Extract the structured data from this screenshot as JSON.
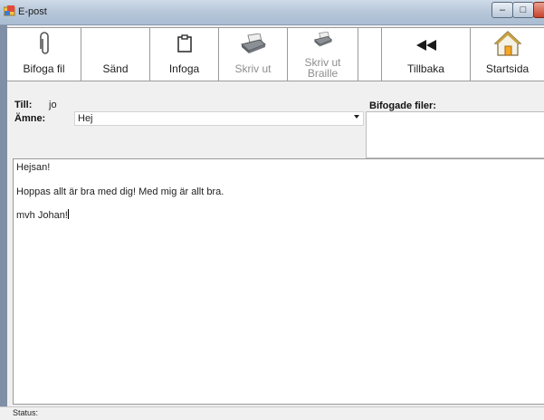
{
  "window": {
    "title": "E-post"
  },
  "toolbar": {
    "items": [
      {
        "label": "Bifoga fil",
        "icon": "paperclip-icon",
        "enabled": true
      },
      {
        "label": "Sänd",
        "icon": "",
        "enabled": true
      },
      {
        "label": "Infoga",
        "icon": "clipboard-icon",
        "enabled": true
      },
      {
        "label": "Skriv ut",
        "icon": "printer-icon",
        "enabled": false
      },
      {
        "label": "Skriv ut Braille",
        "icon": "braille-printer-icon",
        "enabled": false
      },
      {
        "label": "Tillbaka",
        "icon": "rewind-icon",
        "enabled": true
      },
      {
        "label": "Startsida",
        "icon": "home-icon",
        "enabled": true
      }
    ]
  },
  "header": {
    "to_label": "Till:",
    "to_value": "jo",
    "subject_label": "Ämne:",
    "subject_value": "Hej",
    "attachments_label": "Bifogade filer:"
  },
  "body": {
    "lines": [
      "Hejsan!",
      "Hoppas allt är bra med dig! Med mig är allt bra.",
      "mvh Johan!"
    ]
  },
  "status": {
    "label": "Status:"
  },
  "colors": {
    "titlebar": "#b8c8da",
    "close_button": "#c8412b",
    "disabled_text": "#8e8e8e"
  }
}
